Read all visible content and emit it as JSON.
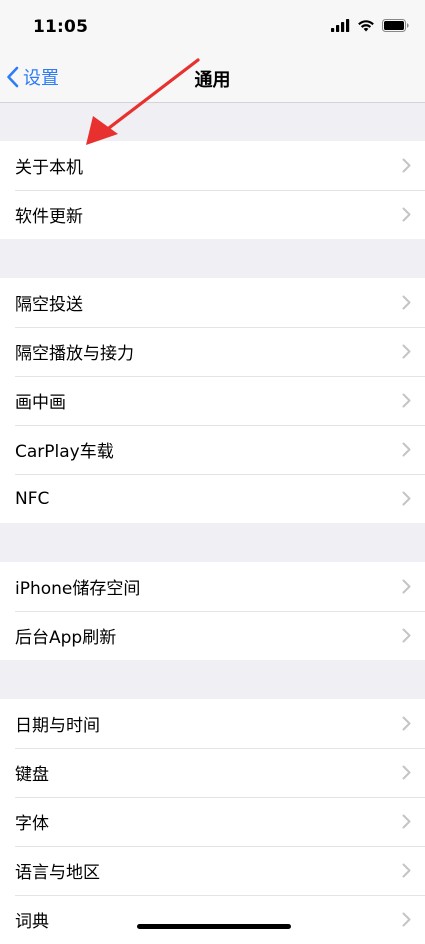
{
  "status_bar": {
    "time": "11:05",
    "icons": [
      "cellular-signal-icon",
      "wifi-icon",
      "battery-icon"
    ]
  },
  "nav": {
    "back_label": "设置",
    "title": "通用"
  },
  "groups": [
    {
      "items": [
        "关于本机",
        "软件更新"
      ]
    },
    {
      "items": [
        "隔空投送",
        "隔空播放与接力",
        "画中画",
        "CarPlay车载",
        "NFC"
      ]
    },
    {
      "items": [
        "iPhone储存空间",
        "后台App刷新"
      ]
    },
    {
      "items": [
        "日期与时间",
        "键盘",
        "字体",
        "语言与地区",
        "词典"
      ]
    }
  ],
  "colors": {
    "accent": "#2f7cf6",
    "annotation_arrow": "#e8312f",
    "background": "#efeff4"
  }
}
